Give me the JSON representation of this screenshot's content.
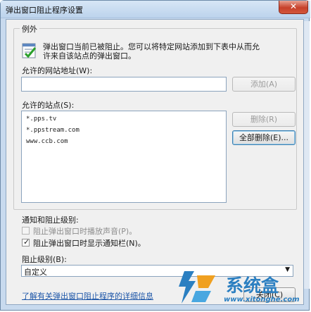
{
  "window": {
    "title": "弹出窗口阻止程序设置",
    "close_label": "✕"
  },
  "exceptions": {
    "legend": "例外",
    "description_line1": "弹出窗口当前已被阻止。您可以将特定网站添加到下表中从而允",
    "description_line2": "许来自该站点的弹出窗口。",
    "address_label": "允许的网站地址(W):",
    "address_value": "",
    "add_button": "添加(A)",
    "allowed_sites_label": "允许的站点(S):",
    "allowed_sites": [
      "*.pps.tv",
      "*.ppstream.com",
      "www.ccb.com"
    ],
    "remove_button": "删除(R)",
    "remove_all_button": "全部删除(E)..."
  },
  "notifications": {
    "section_label": "通知和阻止级别:",
    "play_sound_label": "阻止弹出窗口时播放声音(P)。",
    "play_sound_checked": false,
    "show_bar_label": "阻止弹出窗口时显示通知栏(N)。",
    "show_bar_checked": true,
    "block_level_label": "阻止级别(B):",
    "block_level_value": "自定义"
  },
  "footer": {
    "learn_more_link": "了解有关弹出窗口阻止程序的详细信息",
    "close_button": "关闭(C)"
  },
  "watermark": {
    "brand": "系统盒",
    "url": "www.xitonghe.com"
  },
  "colors": {
    "accent": "#1d56a8",
    "close_red": "#c7412b",
    "watermark_blue": "#2b7fc1"
  }
}
